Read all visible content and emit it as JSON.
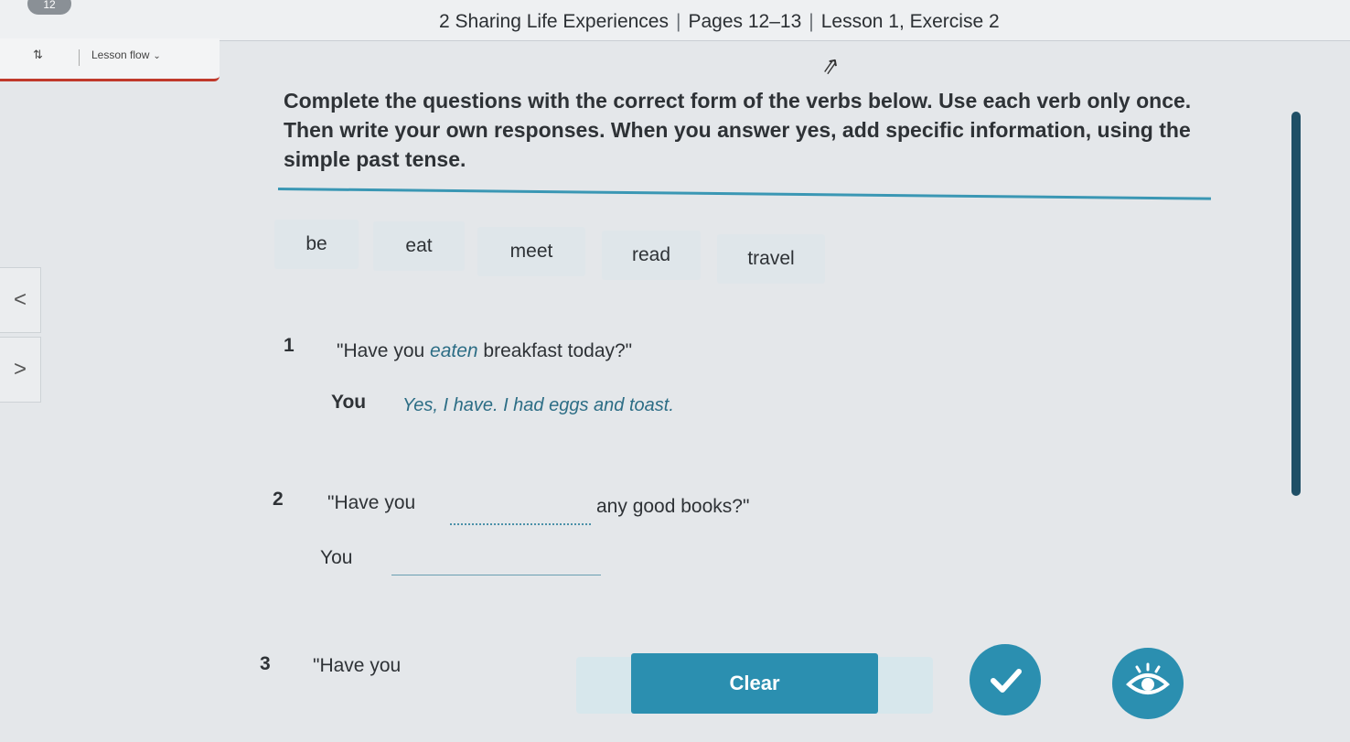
{
  "header": {
    "badge": "12",
    "unit": "2 Sharing Life Experiences",
    "pages": "Pages 12–13",
    "lesson": "Lesson 1, Exercise 2"
  },
  "lesson_flow": {
    "icon": "⇅",
    "label": "Lesson flow"
  },
  "instructions": "Complete the questions with the correct form of the verbs below. Use each verb only once. Then write your own responses. When you answer yes, add specific information, using the simple past tense.",
  "word_bank": [
    "be",
    "eat",
    "meet",
    "read",
    "travel"
  ],
  "questions": [
    {
      "number": "1",
      "before": "\"Have you ",
      "example_verb": "eaten",
      "after": " breakfast today?\"",
      "you_label": "You",
      "answer": "Yes, I have. I had eggs and toast."
    },
    {
      "number": "2",
      "before": "\"Have you",
      "after": "any good books?\"",
      "you_label": "You"
    },
    {
      "number": "3",
      "before": "\"Have you"
    }
  ],
  "nav": {
    "prev": "<",
    "next": ">"
  },
  "buttons": {
    "clear": "Clear",
    "check_icon": "check-icon",
    "show_answers_icon": "eye-icon"
  },
  "colors": {
    "accent": "#2b8fb0",
    "rule": "#3a97b4",
    "example_answer": "#2c6d85"
  }
}
